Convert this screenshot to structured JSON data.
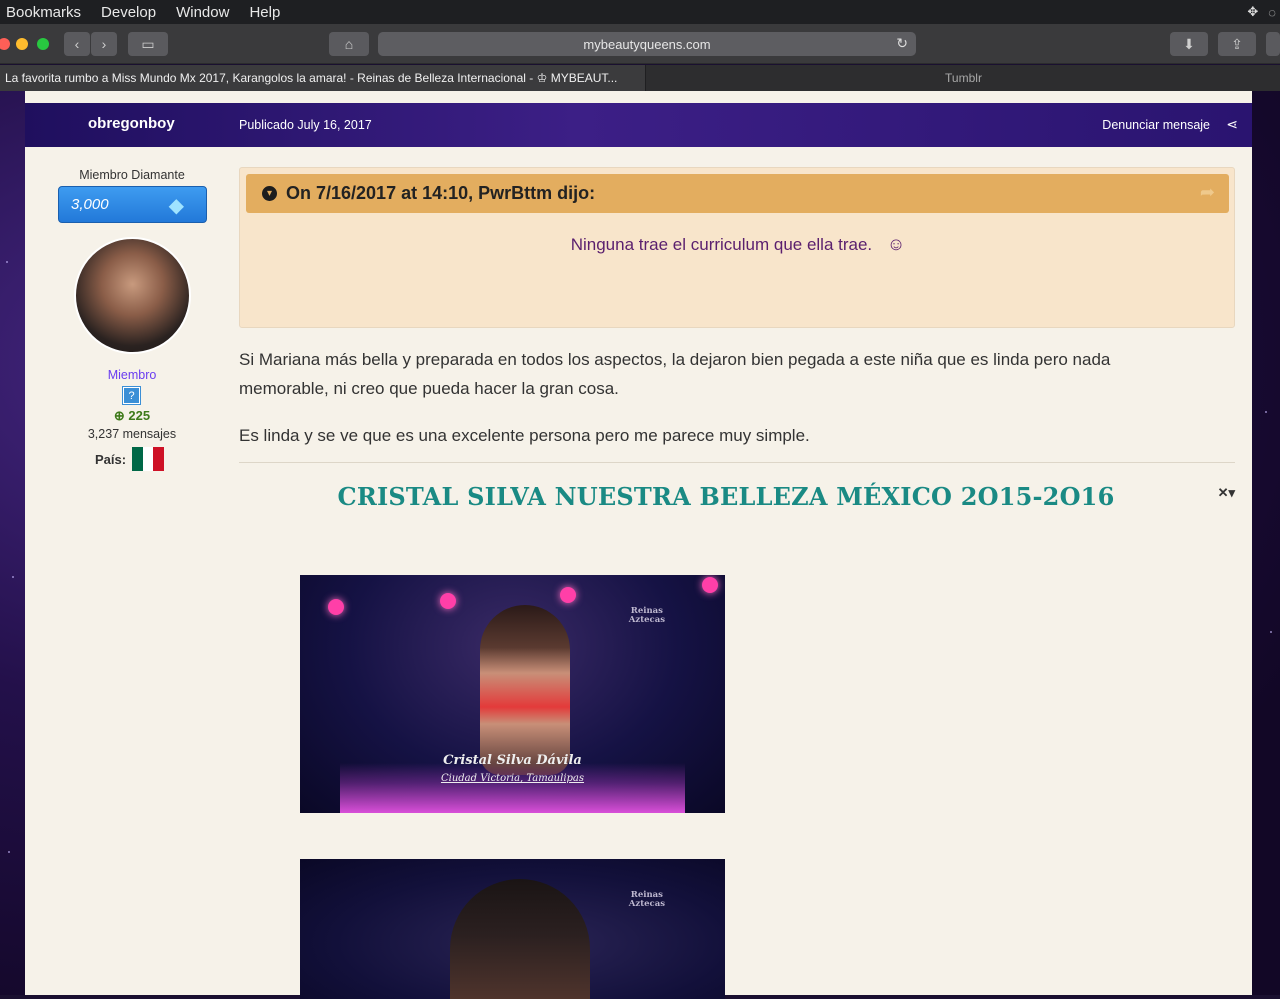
{
  "menubar": {
    "items": [
      "Bookmarks",
      "Develop",
      "Window",
      "Help"
    ]
  },
  "browser": {
    "url": "mybeautyqueens.com",
    "tabs": [
      {
        "label": "La favorita rumbo a Miss Mundo Mx 2017, Karangolos la amara! - Reinas de Belleza Internacional - ♔ MYBEAUT..."
      },
      {
        "label": "Tumblr"
      }
    ]
  },
  "post": {
    "author": "obregonboy",
    "published": "Publicado July 16, 2017",
    "report_label": "Denunciar mensaje",
    "author_panel": {
      "rank_title": "Miembro Diamante",
      "rank_points": "3,000",
      "group": "Miembro",
      "group_icon": "?",
      "reputation": "225",
      "post_count": "3,237 mensajes",
      "country_label": "País:",
      "country_flag_colors": [
        "#006847",
        "#ffffff",
        "#ce1126"
      ]
    },
    "quote": {
      "citation": "On 7/16/2017 at 14:10, PwrBttm dijo:",
      "text": "Ninguna trae el curriculum que ella trae."
    },
    "paragraphs": [
      "Si Mariana más bella y preparada en todos los aspectos, la dejaron bien pegada a este niña que es linda pero nada memorable, ni creo que pueda hacer la gran cosa.",
      "Es linda y se ve que es una excelente persona pero me parece muy simple."
    ],
    "embed_title": "CRISTAL SILVA NUESTRA BELLEZA MÉXICO 2O15-2O16",
    "video1": {
      "watermark_line1": "Reinas",
      "watermark_line2": "Aztecas",
      "caption_name": "Cristal Silva Dávila",
      "caption_city": "Ciudad Victoria, Tamaulipas"
    },
    "video2": {
      "watermark_line1": "Reinas",
      "watermark_line2": "Aztecas"
    }
  },
  "colors": {
    "accent_header": "#2a1470",
    "quote_header": "#e3ad5f",
    "quote_bg": "#f8e5cb",
    "headline": "#1a8a84"
  }
}
